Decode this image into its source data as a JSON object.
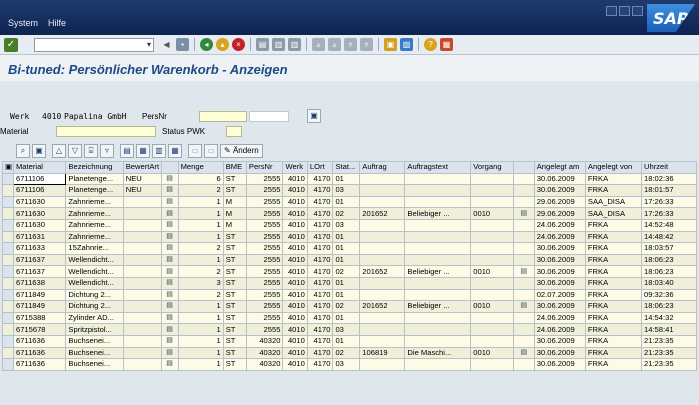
{
  "menubar": {
    "items": [
      {
        "label": "System",
        "u": "S"
      },
      {
        "label": "Hilfe",
        "u": "H"
      }
    ],
    "logo": "SAP"
  },
  "stdbar": {
    "command_value": ""
  },
  "title": "Bi-tuned: Persönlicher Warenkorb - Anzeigen",
  "selection": {
    "werk_label": "Werk",
    "werk_value": "4010",
    "werk_text": "Papalina GmbH",
    "persnr_label": "PersNr",
    "persnr_value": "",
    "material_label": "Material",
    "material_value": "",
    "status_label": "Status PWK",
    "status_value": ""
  },
  "alv": {
    "andern_label": "Ändern"
  },
  "columns": [
    "Material",
    "Bezeichnung",
    "BewertArt",
    "",
    "Menge",
    "BME",
    "PersNr",
    "Werk",
    "LOrt",
    "Stat...",
    "Auftrag",
    "Auftragstext",
    "Vorgang",
    "",
    "Angelegt am",
    "Angelegt von",
    "Uhrzeit"
  ],
  "rows": [
    [
      "6711106",
      "Planetenge...",
      "NEU",
      "6",
      "ST",
      "2555",
      "4010",
      "4170",
      "01",
      "",
      "",
      "",
      "30.06.2009",
      "FRKA",
      "18:02:36"
    ],
    [
      "6711106",
      "Planetenge...",
      "NEU",
      "2",
      "ST",
      "2555",
      "4010",
      "4170",
      "03",
      "",
      "",
      "",
      "30.06.2009",
      "FRKA",
      "18:01:57"
    ],
    [
      "6711630",
      "Zahnrieme...",
      "",
      "1",
      "M",
      "2555",
      "4010",
      "4170",
      "01",
      "",
      "",
      "",
      "29.06.2009",
      "SAA_DISA",
      "17:26:33"
    ],
    [
      "6711630",
      "Zahnrieme...",
      "",
      "1",
      "M",
      "2555",
      "4010",
      "4170",
      "02",
      "201652",
      "Beliebiger ...",
      "0010",
      "29.06.2009",
      "SAA_DISA",
      "17:26:33"
    ],
    [
      "6711630",
      "Zahnrieme...",
      "",
      "1",
      "M",
      "2555",
      "4010",
      "4170",
      "03",
      "",
      "",
      "",
      "24.06.2009",
      "FRKA",
      "14:52:48"
    ],
    [
      "6711631",
      "Zahnrieme...",
      "",
      "1",
      "ST",
      "2555",
      "4010",
      "4170",
      "01",
      "",
      "",
      "",
      "24.06.2009",
      "FRKA",
      "14:48:42"
    ],
    [
      "6711633",
      "15Zahnrie...",
      "",
      "2",
      "ST",
      "2555",
      "4010",
      "4170",
      "01",
      "",
      "",
      "",
      "30.06.2009",
      "FRKA",
      "18:03:57"
    ],
    [
      "6711637",
      "Wellendicht...",
      "",
      "1",
      "ST",
      "2555",
      "4010",
      "4170",
      "01",
      "",
      "",
      "",
      "30.06.2009",
      "FRKA",
      "18:06:23"
    ],
    [
      "6711637",
      "Wellendicht...",
      "",
      "2",
      "ST",
      "2555",
      "4010",
      "4170",
      "02",
      "201652",
      "Beliebiger ...",
      "0010",
      "30.06.2009",
      "FRKA",
      "18:06:23"
    ],
    [
      "6711638",
      "Wellendicht...",
      "",
      "3",
      "ST",
      "2555",
      "4010",
      "4170",
      "01",
      "",
      "",
      "",
      "30.06.2009",
      "FRKA",
      "18:03:40"
    ],
    [
      "6711849",
      "Dichtung 2...",
      "",
      "2",
      "ST",
      "2555",
      "4010",
      "4170",
      "01",
      "",
      "",
      "",
      "02.07.2009",
      "FRKA",
      "09:32:36"
    ],
    [
      "6711849",
      "Dichtung 2...",
      "",
      "1",
      "ST",
      "2555",
      "4010",
      "4170",
      "02",
      "201652",
      "Beliebiger ...",
      "0010",
      "30.06.2009",
      "FRKA",
      "18:06:23"
    ],
    [
      "6715388",
      "Zylinder AD...",
      "",
      "1",
      "ST",
      "2555",
      "4010",
      "4170",
      "01",
      "",
      "",
      "",
      "24.06.2009",
      "FRKA",
      "14:54:32"
    ],
    [
      "6715678",
      "Spritzpistol...",
      "",
      "1",
      "ST",
      "2555",
      "4010",
      "4170",
      "03",
      "",
      "",
      "",
      "24.06.2009",
      "FRKA",
      "14:58:41"
    ],
    [
      "6711636",
      "Buchsenei...",
      "",
      "1",
      "ST",
      "40320",
      "4010",
      "4170",
      "01",
      "",
      "",
      "",
      "30.06.2009",
      "FRKA",
      "21:23:35"
    ],
    [
      "6711636",
      "Buchsenei...",
      "",
      "1",
      "ST",
      "40320",
      "4010",
      "4170",
      "02",
      "106819",
      "Die Maschi...",
      "0010",
      "30.06.2009",
      "FRKA",
      "21:23:35"
    ],
    [
      "6711636",
      "Buchsenei...",
      "",
      "1",
      "ST",
      "40320",
      "4010",
      "4170",
      "03",
      "",
      "",
      "",
      "30.06.2009",
      "FRKA",
      "21:23:35"
    ]
  ]
}
